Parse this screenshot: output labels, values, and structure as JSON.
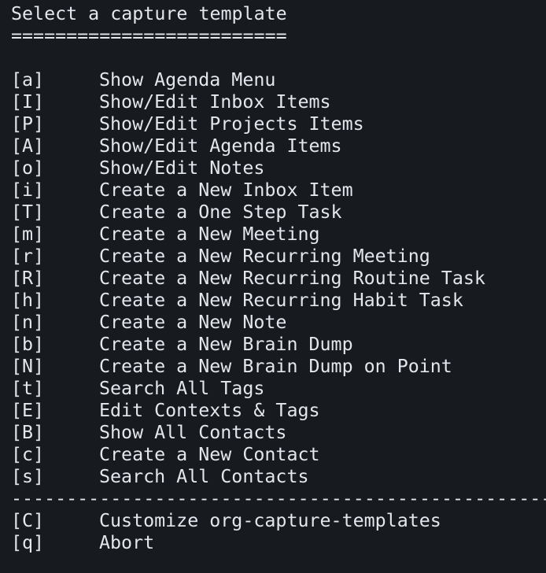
{
  "title": "Select a capture template",
  "title_underline": "=========================",
  "menu_items": [
    {
      "key": "[a]",
      "label": "Show Agenda Menu"
    },
    {
      "key": "[I]",
      "label": "Show/Edit Inbox Items"
    },
    {
      "key": "[P]",
      "label": "Show/Edit Projects Items"
    },
    {
      "key": "[A]",
      "label": "Show/Edit Agenda Items"
    },
    {
      "key": "[o]",
      "label": "Show/Edit Notes"
    },
    {
      "key": "[i]",
      "label": "Create a New Inbox Item"
    },
    {
      "key": "[T]",
      "label": "Create a One Step Task"
    },
    {
      "key": "[m]",
      "label": "Create a New Meeting"
    },
    {
      "key": "[r]",
      "label": "Create a New Recurring Meeting"
    },
    {
      "key": "[R]",
      "label": "Create a New Recurring Routine Task"
    },
    {
      "key": "[h]",
      "label": "Create a New Recurring Habit Task"
    },
    {
      "key": "[n]",
      "label": "Create a New Note"
    },
    {
      "key": "[b]",
      "label": "Create a New Brain Dump"
    },
    {
      "key": "[N]",
      "label": "Create a New Brain Dump on Point"
    },
    {
      "key": "[t]",
      "label": "Search All Tags"
    },
    {
      "key": "[E]",
      "label": "Edit Contexts & Tags"
    },
    {
      "key": "[B]",
      "label": "Show All Contacts"
    },
    {
      "key": "[c]",
      "label": "Create a New Contact"
    },
    {
      "key": "[s]",
      "label": "Search All Contacts"
    }
  ],
  "separator": "----------------------------------------------------------------",
  "footer_items": [
    {
      "key": "[C]",
      "label": "Customize org-capture-templates"
    },
    {
      "key": "[q]",
      "label": "Abort"
    }
  ]
}
